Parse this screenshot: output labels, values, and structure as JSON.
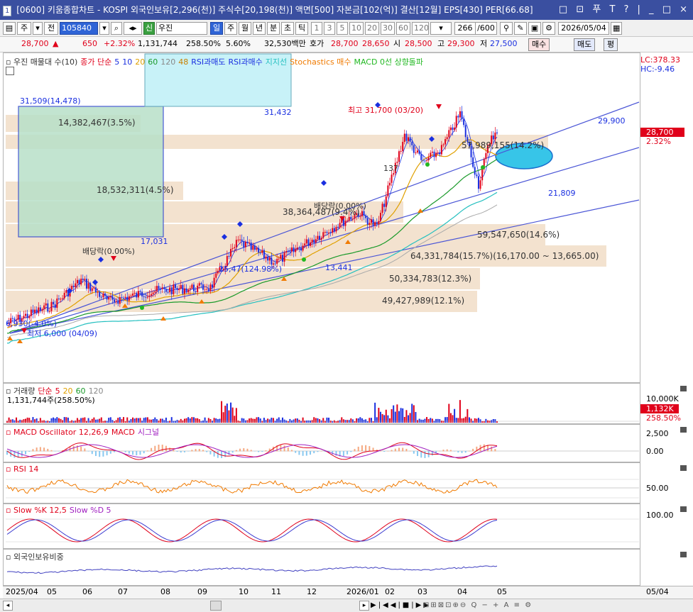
{
  "titlebar": {
    "screen_no": "1",
    "title": "[0600] 키움종합차트 - KOSPI 외국인보유[2,296(천)] 주식수[20,198(천)] 액면[500] 자본금[102(억)] 결산[12월] EPS[430] PER[66.68]",
    "controls": "□ ⊡ 푸 T ? | _ □ ×"
  },
  "toolbar": {
    "market1": "주",
    "market2": "전",
    "code": "105840",
    "credit_badge": "신",
    "stock_name": "우진",
    "periods": [
      "일",
      "주",
      "월",
      "년",
      "분",
      "초",
      "틱"
    ],
    "active_period": "일",
    "intervals": [
      "1",
      "3",
      "5",
      "10",
      "20",
      "30",
      "60",
      "120"
    ],
    "count_value": "266",
    "count_total": "/600",
    "date": "2026/05/04"
  },
  "quote": {
    "price": "28,700",
    "arrow": "▲",
    "change": "650",
    "change_pct": "+2.32%",
    "volume": "1,131,744",
    "volume_ratio": "258.50%",
    "turnover": "5.60%",
    "amount": "32,530백만",
    "hoga_label": "호가",
    "ask": "28,700",
    "bid": "28,650",
    "open_label": "시",
    "open": "28,500",
    "high_label": "고",
    "high": "29,300",
    "low_label": "저",
    "low": "27,500",
    "buy_btn": "매수",
    "sell_btn": "매도",
    "avg_btn": "평"
  },
  "price_pane": {
    "legend": [
      {
        "text": "우진 매물대 수(10)",
        "color": "#333333"
      },
      {
        "text": "종가 단순",
        "color": "#e0001a"
      },
      {
        "text": "5",
        "color": "#1a2fe0"
      },
      {
        "text": "10",
        "color": "#1a2fe0"
      },
      {
        "text": "20",
        "color": "#e0a000"
      },
      {
        "text": "60",
        "color": "#1a9a2a"
      },
      {
        "text": "120",
        "color": "#888888"
      },
      {
        "text": "48",
        "color": "#c88000"
      },
      {
        "text": "RSI과매도",
        "color": "#1a2fe0"
      },
      {
        "text": "RSI과매수",
        "color": "#1a2fe0"
      },
      {
        "text": "지지선",
        "color": "#26c0c0"
      },
      {
        "text": "Stochastics 매수",
        "color": "#f07a00"
      },
      {
        "text": "MACD 0선 상향돌파",
        "color": "#22b822"
      }
    ],
    "lc": "LC:378.33",
    "hc": "HC:-9.46",
    "current_price": "28,700",
    "current_pct": "2.32%",
    "volume_profile": [
      {
        "label": "14,382,467(3.5%)"
      },
      {
        "label": "18,532,311(4.5%)"
      },
      {
        "label": "38,364,487(9.4%)"
      },
      {
        "label": "57,989,155(14.2%)"
      },
      {
        "label": "59,547,650(14.6%)"
      },
      {
        "label": "64,331,784(15.7%)(16,170.00 ~ 13,665.00)"
      },
      {
        "label": "50,334,783(12.3%)"
      },
      {
        "label": "49,427,989(12.1%)"
      }
    ],
    "annotations": {
      "box1_top": "31,509(14,478)",
      "box2_val": "31,432",
      "box1_bottom": "17,031",
      "dividend1": "배당락(0.00%)",
      "dividend2": "배당락(0.00%)",
      "high_mark": "최고 31,700 (03/20)",
      "low_mark": "최저 6,000 (04/09)",
      "trend_low": "6,930(-4.0%)",
      "mid1": "25,47(124.98%)",
      "mid2": "13,441",
      "trend_high": "29,900",
      "trend_mid": "21,809",
      "mid3": "137"
    }
  },
  "volume_pane": {
    "legend": [
      {
        "text": "거래량",
        "color": "#333333"
      },
      {
        "text": "단순",
        "color": "#e0001a"
      },
      {
        "text": "5",
        "color": "#e0001a"
      },
      {
        "text": "20",
        "color": "#e0a000"
      },
      {
        "text": "60",
        "color": "#1a9a2a"
      },
      {
        "text": "120",
        "color": "#888888"
      }
    ],
    "value_text": "1,131,744주(258.50%)",
    "axis": "10,000K",
    "badge": "1,132K",
    "badge_pct": "258.50%"
  },
  "macd_pane": {
    "legend": [
      {
        "text": "MACD Oscillator 12,26,9",
        "color": "#e0001a"
      },
      {
        "text": "MACD",
        "color": "#e0001a"
      },
      {
        "text": "시그널",
        "color": "#a020c0"
      }
    ],
    "axis_top": "2,500",
    "axis_mid": "0.00"
  },
  "rsi_pane": {
    "legend": [
      {
        "text": "RSI 14",
        "color": "#e0001a"
      }
    ],
    "axis": "50.00"
  },
  "stoch_pane": {
    "legend": [
      {
        "text": "Slow %K 12,5",
        "color": "#e0001a"
      },
      {
        "text": "Slow %D 5",
        "color": "#a020c0"
      }
    ],
    "axis": "100.00"
  },
  "foreign_pane": {
    "legend": [
      {
        "text": "외국인보유비중",
        "color": "#333333"
      }
    ]
  },
  "xaxis": {
    "labels": [
      "2025/04",
      "05",
      "06",
      "07",
      "08",
      "09",
      "10",
      "11",
      "12",
      "2026/01",
      "02",
      "03",
      "04",
      "05"
    ],
    "right_label": "05/04"
  },
  "colors": {
    "up": "#e0001a",
    "down": "#1a2fe0",
    "profile": "#f3e2cf",
    "box": "#c8f2f8",
    "box_green": "#b8e0c8"
  }
}
